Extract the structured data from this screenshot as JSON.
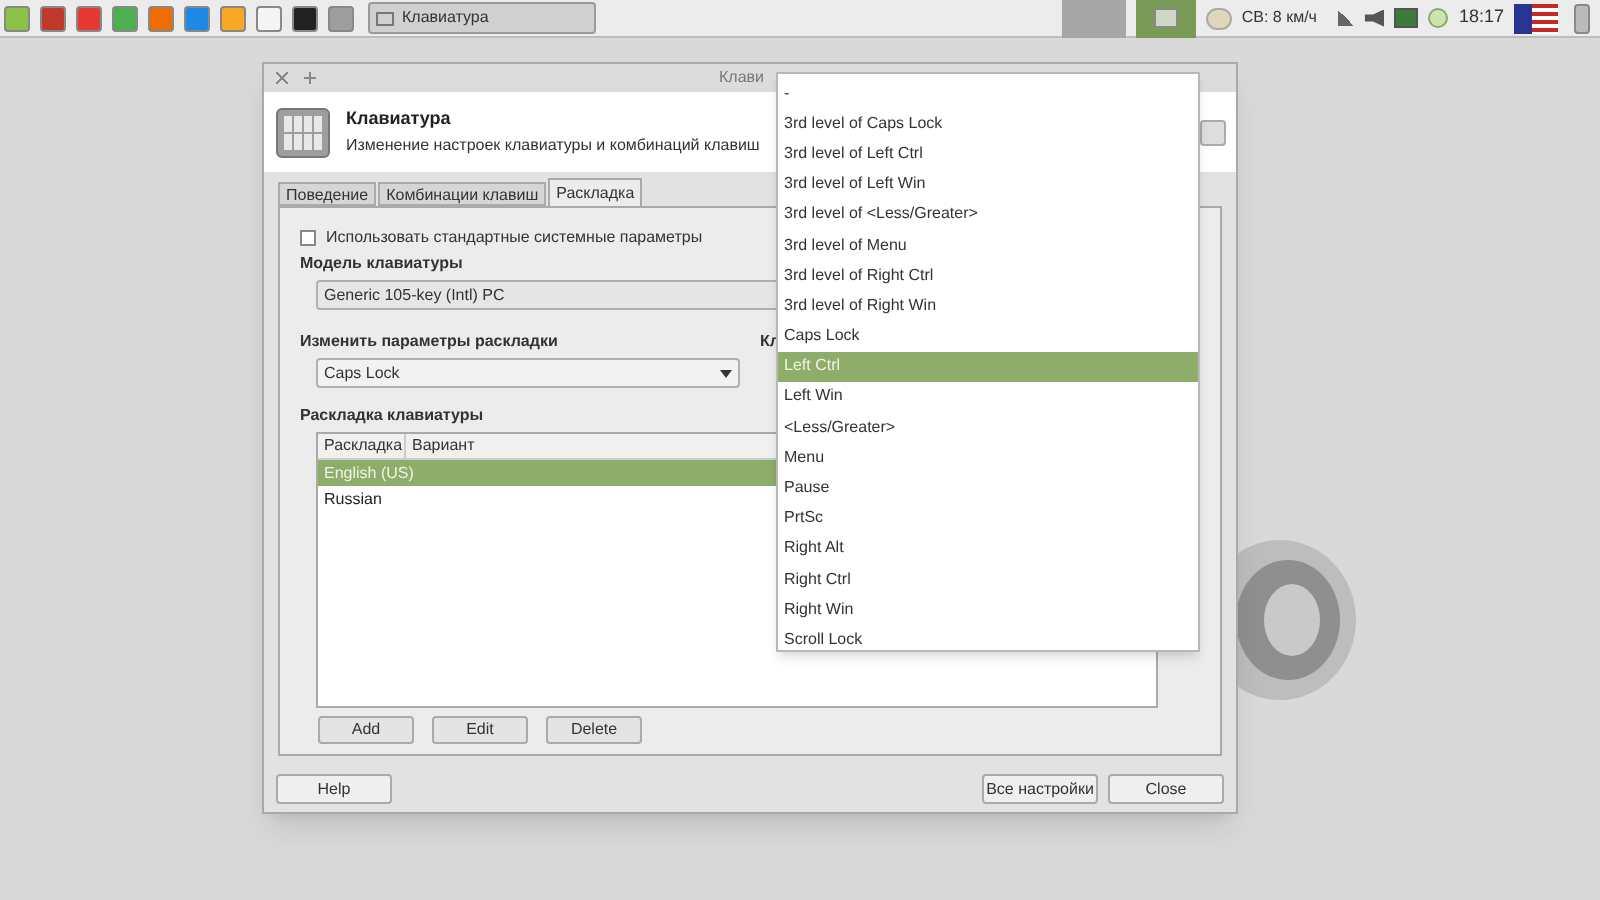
{
  "taskbar": {
    "window_button": {
      "label": "Клавиатура"
    },
    "weather": "СВ: 8 км/ч",
    "clock": "18:17"
  },
  "window": {
    "title": "Клави",
    "header": {
      "title": "Клавиатура",
      "subtitle": "Изменение настроек клавиатуры и комбинаций клавиш"
    },
    "tabs": [
      {
        "label": "Поведение",
        "selected": false
      },
      {
        "label": "Комбинации клавиш",
        "selected": false
      },
      {
        "label": "Раскладка",
        "selected": true
      }
    ],
    "use_defaults": {
      "label": "Использовать стандартные системные параметры",
      "checked": false
    },
    "model": {
      "label": "Модель клавиатуры",
      "value": "Generic 105-key (Intl) PC"
    },
    "options": {
      "label": "Изменить параметры раскладки",
      "value": "Caps Lock"
    },
    "column_2_label": "Кл",
    "layouts": {
      "label": "Раскладка клавиатуры",
      "columns": [
        "Раскладка",
        "Вариант"
      ],
      "rows": [
        {
          "label": "English (US)",
          "selected": true
        },
        {
          "label": "Russian",
          "selected": false
        }
      ],
      "buttons": [
        "Add",
        "Edit",
        "Delete"
      ]
    },
    "footer": {
      "left": [
        "Help"
      ],
      "right": [
        "Все настройки",
        "Close"
      ]
    }
  },
  "dropdown": {
    "items": [
      {
        "label": "-",
        "selected": false
      },
      {
        "label": "3rd level of Caps Lock",
        "selected": false
      },
      {
        "label": "3rd level of Left Ctrl",
        "selected": false
      },
      {
        "label": "3rd level of Left Win",
        "selected": false
      },
      {
        "label": "3rd level of <Less/Greater>",
        "selected": false
      },
      {
        "label": "3rd level of Menu",
        "selected": false
      },
      {
        "label": "3rd level of Right Ctrl",
        "selected": false
      },
      {
        "label": "3rd level of Right Win",
        "selected": false
      },
      {
        "label": "Caps Lock",
        "selected": false
      },
      {
        "label": "Left Ctrl",
        "selected": true
      },
      {
        "label": "Left Win",
        "selected": false
      },
      {
        "label": "<Less/Greater>",
        "selected": false
      },
      {
        "label": "Menu",
        "selected": false
      },
      {
        "label": "Pause",
        "selected": false
      },
      {
        "label": "PrtSc",
        "selected": false
      },
      {
        "label": "Right Alt",
        "selected": false
      },
      {
        "label": "Right Ctrl",
        "selected": false
      },
      {
        "label": "Right Win",
        "selected": false
      },
      {
        "label": "Scroll Lock",
        "selected": false
      }
    ]
  }
}
